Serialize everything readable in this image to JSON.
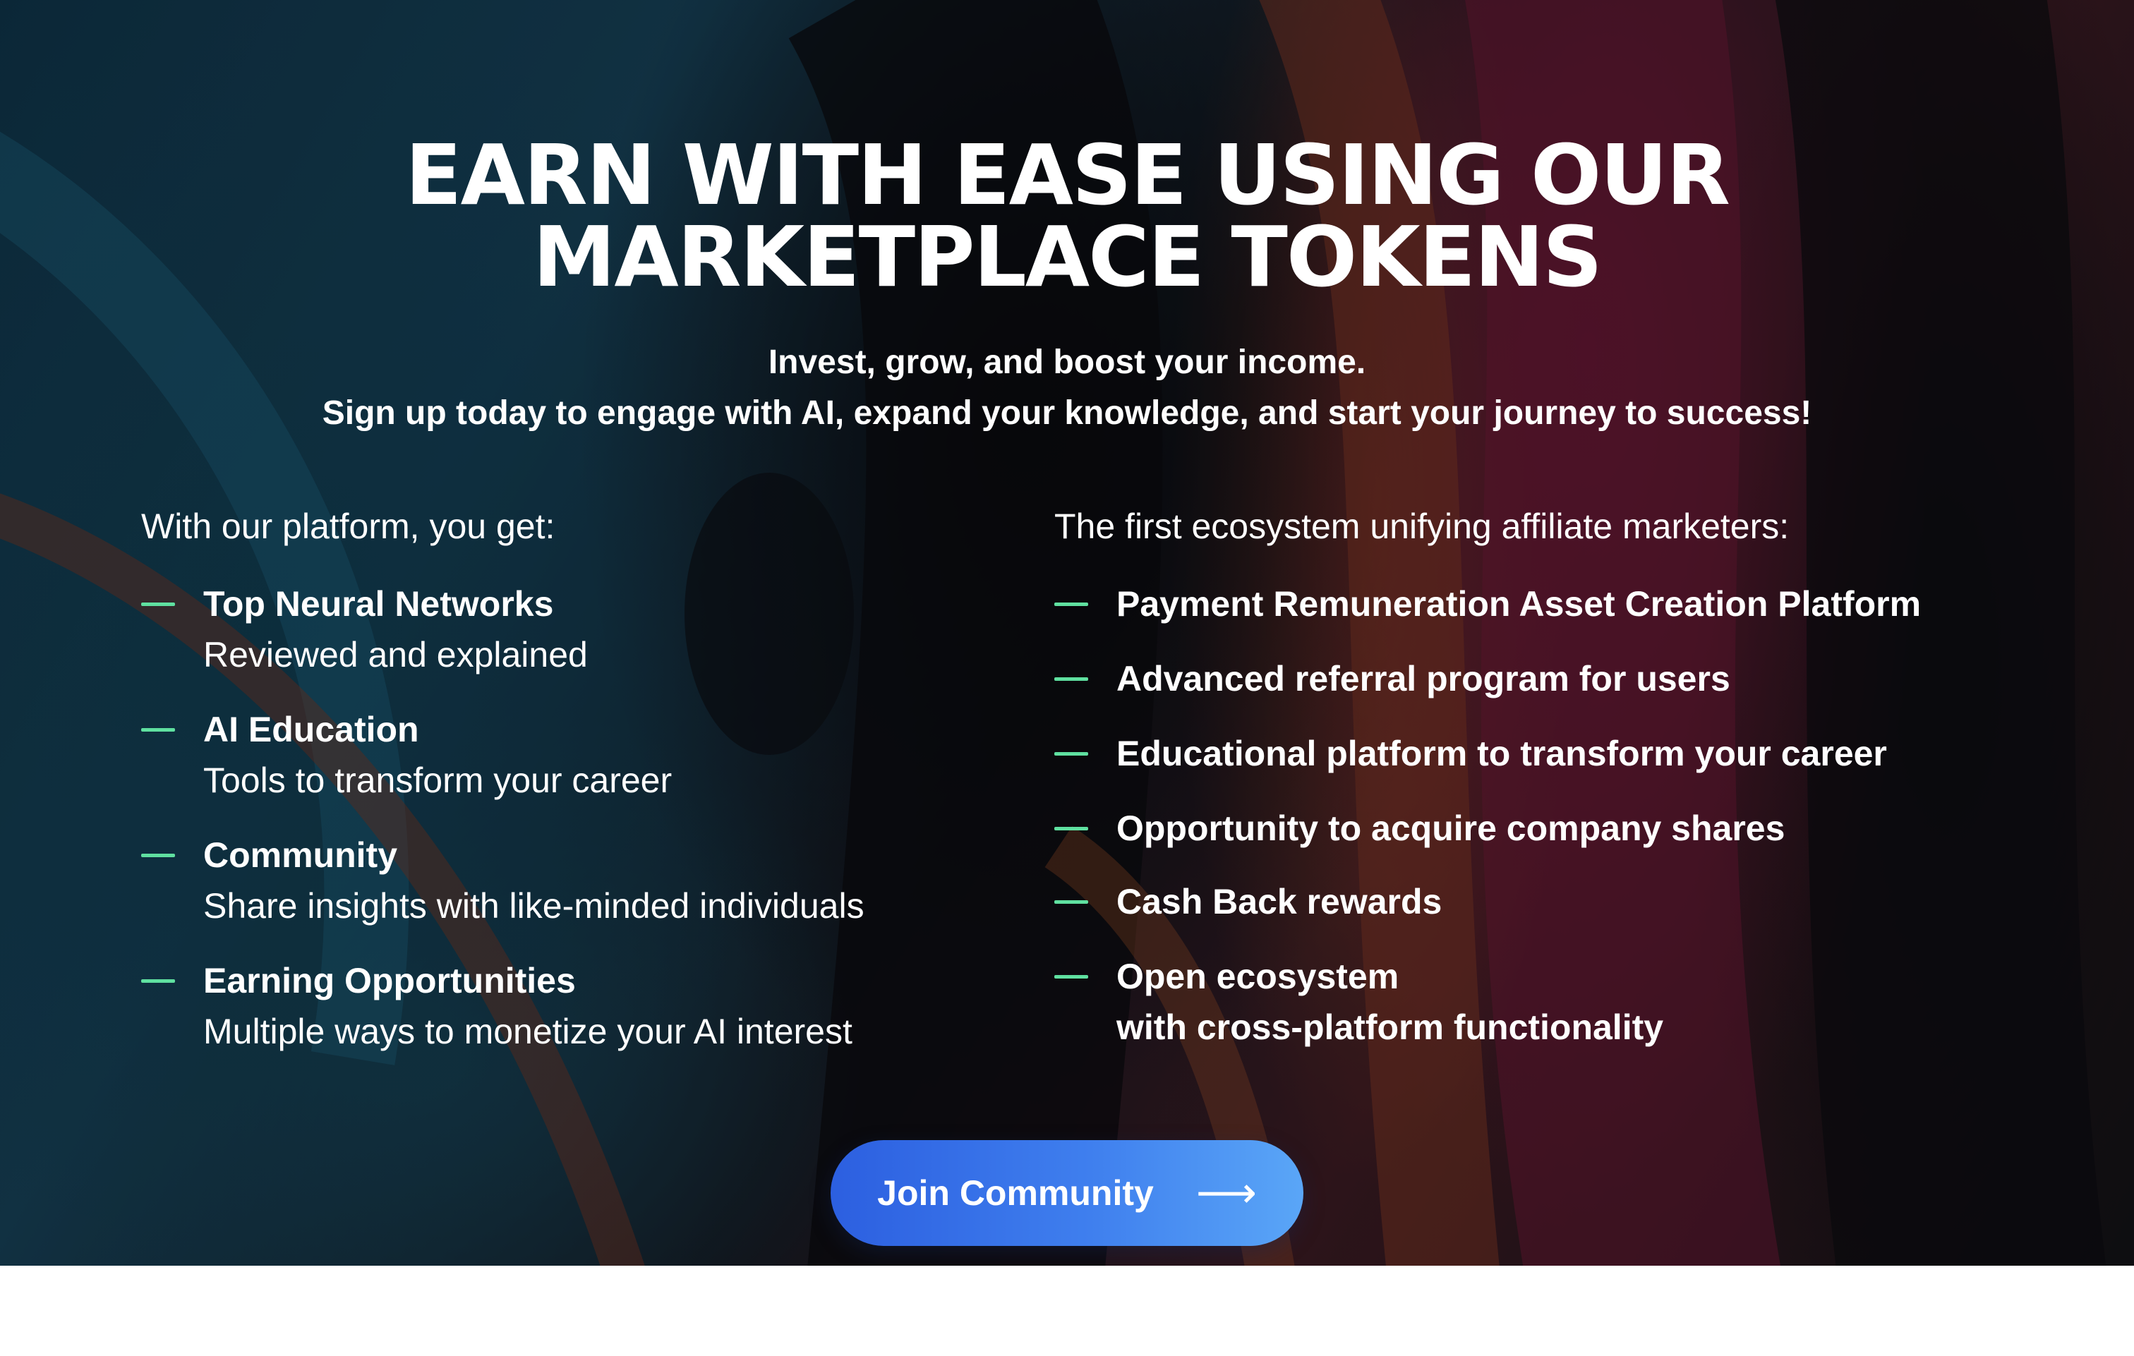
{
  "hero": {
    "headline_line1": "EARN WITH EASE USING OUR",
    "headline_line2": "MARKETPLACE TOKENS",
    "subheadline_line1": "Invest, grow, and boost your income.",
    "subheadline_line2": "Sign up today to engage with AI, expand your knowledge, and start your journey to success!"
  },
  "left_column": {
    "title": "With our platform, you get:",
    "items": [
      {
        "title": "Top Neural Networks",
        "description": "Reviewed and explained"
      },
      {
        "title": "AI Education",
        "description": "Tools to transform your career"
      },
      {
        "title": "Community",
        "description": "Share insights with like-minded individuals"
      },
      {
        "title": "Earning Opportunities",
        "description": "Multiple ways to monetize your AI interest"
      }
    ]
  },
  "right_column": {
    "title": "The first ecosystem unifying affiliate marketers:",
    "items": [
      {
        "title": "Payment Remuneration Asset Creation Platform"
      },
      {
        "title": "Advanced referral program for users"
      },
      {
        "title": "Educational platform to transform your career"
      },
      {
        "title": "Opportunity to acquire company shares"
      },
      {
        "title": "Cash Back rewards"
      },
      {
        "title": "Open ecosystem",
        "title_line2": "with cross-platform functionality"
      }
    ]
  },
  "cta": {
    "label": "Join Community",
    "icon": "arrow-right-icon"
  },
  "colors": {
    "accent_dash": "#5fe0a0",
    "button_gradient_start": "#2c5fe0",
    "button_gradient_end": "#5aa6f7",
    "text": "#ffffff"
  }
}
